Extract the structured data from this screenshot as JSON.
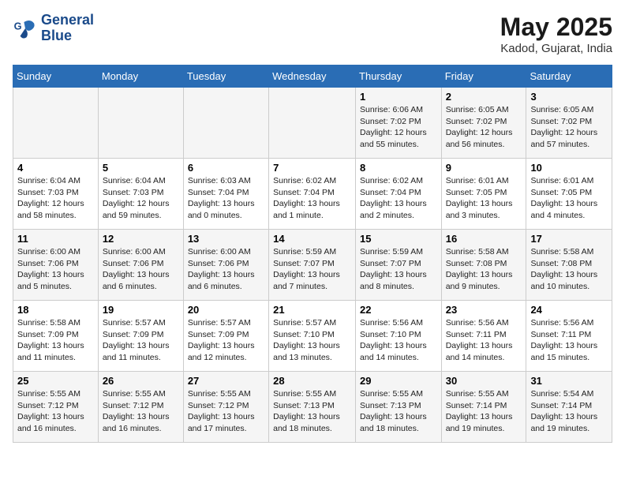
{
  "header": {
    "logo_line1": "General",
    "logo_line2": "Blue",
    "month": "May 2025",
    "location": "Kadod, Gujarat, India"
  },
  "days_of_week": [
    "Sunday",
    "Monday",
    "Tuesday",
    "Wednesday",
    "Thursday",
    "Friday",
    "Saturday"
  ],
  "weeks": [
    [
      {
        "day": "",
        "content": ""
      },
      {
        "day": "",
        "content": ""
      },
      {
        "day": "",
        "content": ""
      },
      {
        "day": "",
        "content": ""
      },
      {
        "day": "1",
        "content": "Sunrise: 6:06 AM\nSunset: 7:02 PM\nDaylight: 12 hours and 55 minutes."
      },
      {
        "day": "2",
        "content": "Sunrise: 6:05 AM\nSunset: 7:02 PM\nDaylight: 12 hours and 56 minutes."
      },
      {
        "day": "3",
        "content": "Sunrise: 6:05 AM\nSunset: 7:02 PM\nDaylight: 12 hours and 57 minutes."
      }
    ],
    [
      {
        "day": "4",
        "content": "Sunrise: 6:04 AM\nSunset: 7:03 PM\nDaylight: 12 hours and 58 minutes."
      },
      {
        "day": "5",
        "content": "Sunrise: 6:04 AM\nSunset: 7:03 PM\nDaylight: 12 hours and 59 minutes."
      },
      {
        "day": "6",
        "content": "Sunrise: 6:03 AM\nSunset: 7:04 PM\nDaylight: 13 hours and 0 minutes."
      },
      {
        "day": "7",
        "content": "Sunrise: 6:02 AM\nSunset: 7:04 PM\nDaylight: 13 hours and 1 minute."
      },
      {
        "day": "8",
        "content": "Sunrise: 6:02 AM\nSunset: 7:04 PM\nDaylight: 13 hours and 2 minutes."
      },
      {
        "day": "9",
        "content": "Sunrise: 6:01 AM\nSunset: 7:05 PM\nDaylight: 13 hours and 3 minutes."
      },
      {
        "day": "10",
        "content": "Sunrise: 6:01 AM\nSunset: 7:05 PM\nDaylight: 13 hours and 4 minutes."
      }
    ],
    [
      {
        "day": "11",
        "content": "Sunrise: 6:00 AM\nSunset: 7:06 PM\nDaylight: 13 hours and 5 minutes."
      },
      {
        "day": "12",
        "content": "Sunrise: 6:00 AM\nSunset: 7:06 PM\nDaylight: 13 hours and 6 minutes."
      },
      {
        "day": "13",
        "content": "Sunrise: 6:00 AM\nSunset: 7:06 PM\nDaylight: 13 hours and 6 minutes."
      },
      {
        "day": "14",
        "content": "Sunrise: 5:59 AM\nSunset: 7:07 PM\nDaylight: 13 hours and 7 minutes."
      },
      {
        "day": "15",
        "content": "Sunrise: 5:59 AM\nSunset: 7:07 PM\nDaylight: 13 hours and 8 minutes."
      },
      {
        "day": "16",
        "content": "Sunrise: 5:58 AM\nSunset: 7:08 PM\nDaylight: 13 hours and 9 minutes."
      },
      {
        "day": "17",
        "content": "Sunrise: 5:58 AM\nSunset: 7:08 PM\nDaylight: 13 hours and 10 minutes."
      }
    ],
    [
      {
        "day": "18",
        "content": "Sunrise: 5:58 AM\nSunset: 7:09 PM\nDaylight: 13 hours and 11 minutes."
      },
      {
        "day": "19",
        "content": "Sunrise: 5:57 AM\nSunset: 7:09 PM\nDaylight: 13 hours and 11 minutes."
      },
      {
        "day": "20",
        "content": "Sunrise: 5:57 AM\nSunset: 7:09 PM\nDaylight: 13 hours and 12 minutes."
      },
      {
        "day": "21",
        "content": "Sunrise: 5:57 AM\nSunset: 7:10 PM\nDaylight: 13 hours and 13 minutes."
      },
      {
        "day": "22",
        "content": "Sunrise: 5:56 AM\nSunset: 7:10 PM\nDaylight: 13 hours and 14 minutes."
      },
      {
        "day": "23",
        "content": "Sunrise: 5:56 AM\nSunset: 7:11 PM\nDaylight: 13 hours and 14 minutes."
      },
      {
        "day": "24",
        "content": "Sunrise: 5:56 AM\nSunset: 7:11 PM\nDaylight: 13 hours and 15 minutes."
      }
    ],
    [
      {
        "day": "25",
        "content": "Sunrise: 5:55 AM\nSunset: 7:12 PM\nDaylight: 13 hours and 16 minutes."
      },
      {
        "day": "26",
        "content": "Sunrise: 5:55 AM\nSunset: 7:12 PM\nDaylight: 13 hours and 16 minutes."
      },
      {
        "day": "27",
        "content": "Sunrise: 5:55 AM\nSunset: 7:12 PM\nDaylight: 13 hours and 17 minutes."
      },
      {
        "day": "28",
        "content": "Sunrise: 5:55 AM\nSunset: 7:13 PM\nDaylight: 13 hours and 18 minutes."
      },
      {
        "day": "29",
        "content": "Sunrise: 5:55 AM\nSunset: 7:13 PM\nDaylight: 13 hours and 18 minutes."
      },
      {
        "day": "30",
        "content": "Sunrise: 5:55 AM\nSunset: 7:14 PM\nDaylight: 13 hours and 19 minutes."
      },
      {
        "day": "31",
        "content": "Sunrise: 5:54 AM\nSunset: 7:14 PM\nDaylight: 13 hours and 19 minutes."
      }
    ]
  ]
}
